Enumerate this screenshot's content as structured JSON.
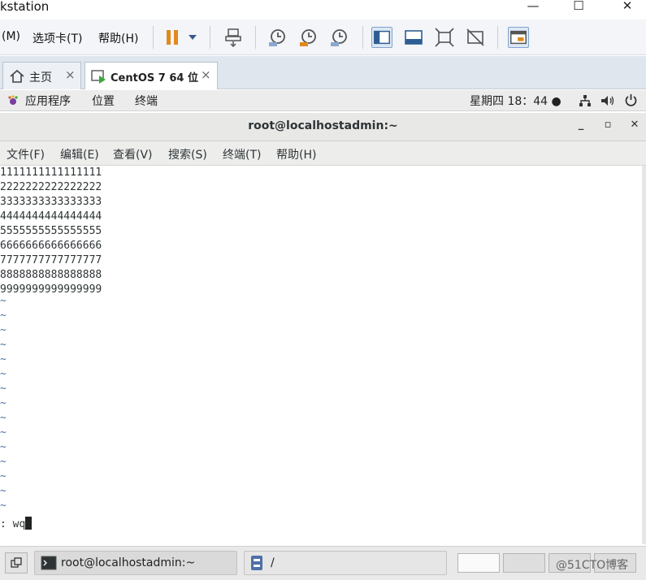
{
  "vmware": {
    "title": "kstation",
    "window_controls": {
      "minimize": "—",
      "maximize": "☐",
      "close": "✕"
    },
    "menus": [
      "(M)",
      "选项卡(T)",
      "帮助(H)"
    ],
    "tabs": [
      {
        "label": "主页",
        "close": "×"
      },
      {
        "label": "CentOS 7 64 位",
        "close": "×"
      }
    ]
  },
  "gnome_panel": {
    "menus": [
      "应用程序",
      "位置",
      "终端"
    ],
    "clock": "星期四 18：44 ●"
  },
  "terminal": {
    "title": "root@localhostadmin:~",
    "controls": {
      "minimize": "_",
      "maximize": "▫",
      "close": "✕"
    },
    "menus": [
      "文件(F)",
      "编辑(E)",
      "查看(V)",
      "搜索(S)",
      "终端(T)",
      "帮助(H)"
    ],
    "lines": [
      "1111111111111111",
      "2222222222222222",
      "3333333333333333",
      "4444444444444444",
      "5555555555555555",
      "6666666666666666",
      "7777777777777777",
      "8888888888888888",
      "9999999999999999"
    ],
    "tilde": "~",
    "command": ": wq"
  },
  "taskbar": {
    "terminal_task": "root@localhostadmin:~",
    "files_task": "/",
    "watermark": "@51CTO博客"
  },
  "colors": {
    "accent": "#4f6fa8",
    "pause": "#e08a1e"
  }
}
